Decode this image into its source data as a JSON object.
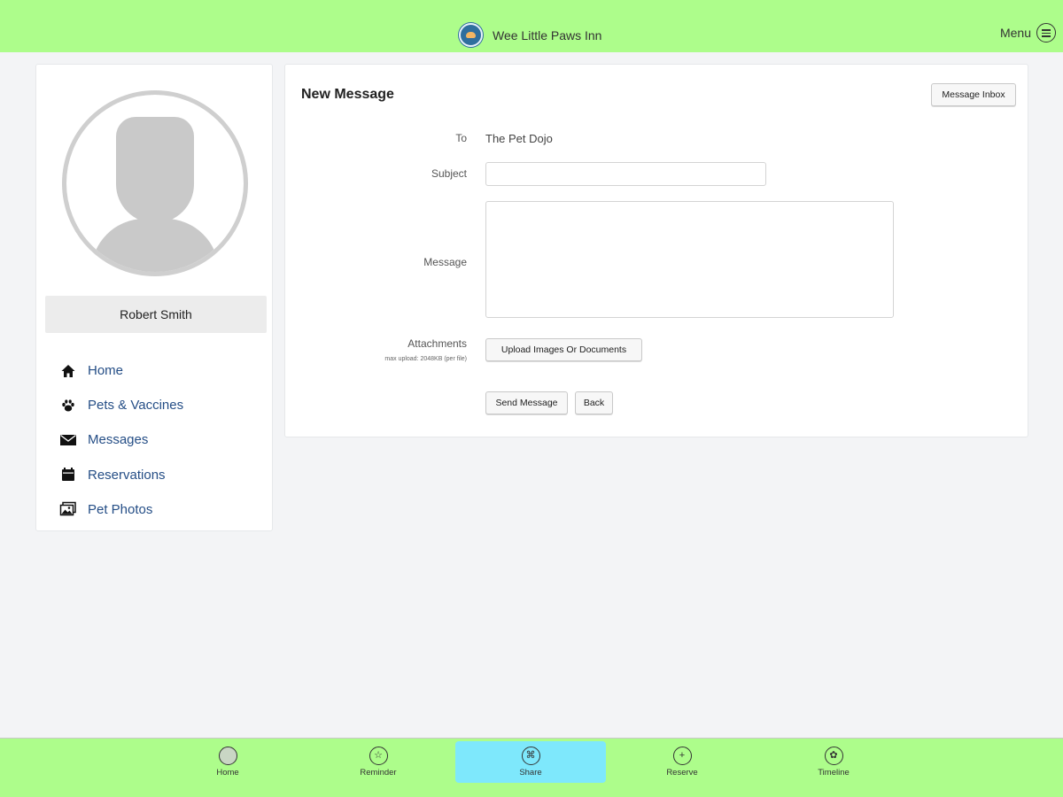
{
  "app": {
    "brand_name": "Wee Little Paws Inn",
    "menu_label": "Menu",
    "brand_color": "#adfd8b",
    "active_tab_color": "#7ee8fc",
    "link_color": "#254e86"
  },
  "sidebar": {
    "user_name": "Robert Smith",
    "nav": [
      {
        "label": "Home",
        "icon": "house-icon"
      },
      {
        "label": "Pets & Vaccines",
        "icon": "paw-icon"
      },
      {
        "label": "Messages",
        "icon": "envelope-icon"
      },
      {
        "label": "Reservations",
        "icon": "calendar-icon"
      },
      {
        "label": "Pet Photos",
        "icon": "photos-icon"
      }
    ]
  },
  "form": {
    "title": "New Message",
    "inbox_button": "Message Inbox",
    "to_label": "To",
    "to_value": "The Pet Dojo",
    "subject_label": "Subject",
    "subject_value": "",
    "message_label": "Message",
    "message_value": "",
    "attachments_label": "Attachments",
    "attachments_note": "max upload: 2048KB (per file)",
    "upload_button": "Upload Images Or Documents",
    "send_button": "Send Message",
    "back_button": "Back"
  },
  "bottom_nav": [
    {
      "label": "Home",
      "icon": "home-circle-icon",
      "glyph": "",
      "active": false
    },
    {
      "label": "Reminder",
      "icon": "star-icon",
      "glyph": "☆",
      "active": false
    },
    {
      "label": "Share",
      "icon": "share-icon",
      "glyph": "⌘",
      "active": true
    },
    {
      "label": "Reserve",
      "icon": "plus-icon",
      "glyph": "+",
      "active": false
    },
    {
      "label": "Timeline",
      "icon": "paw-circle-icon",
      "glyph": "✿",
      "active": false
    }
  ]
}
